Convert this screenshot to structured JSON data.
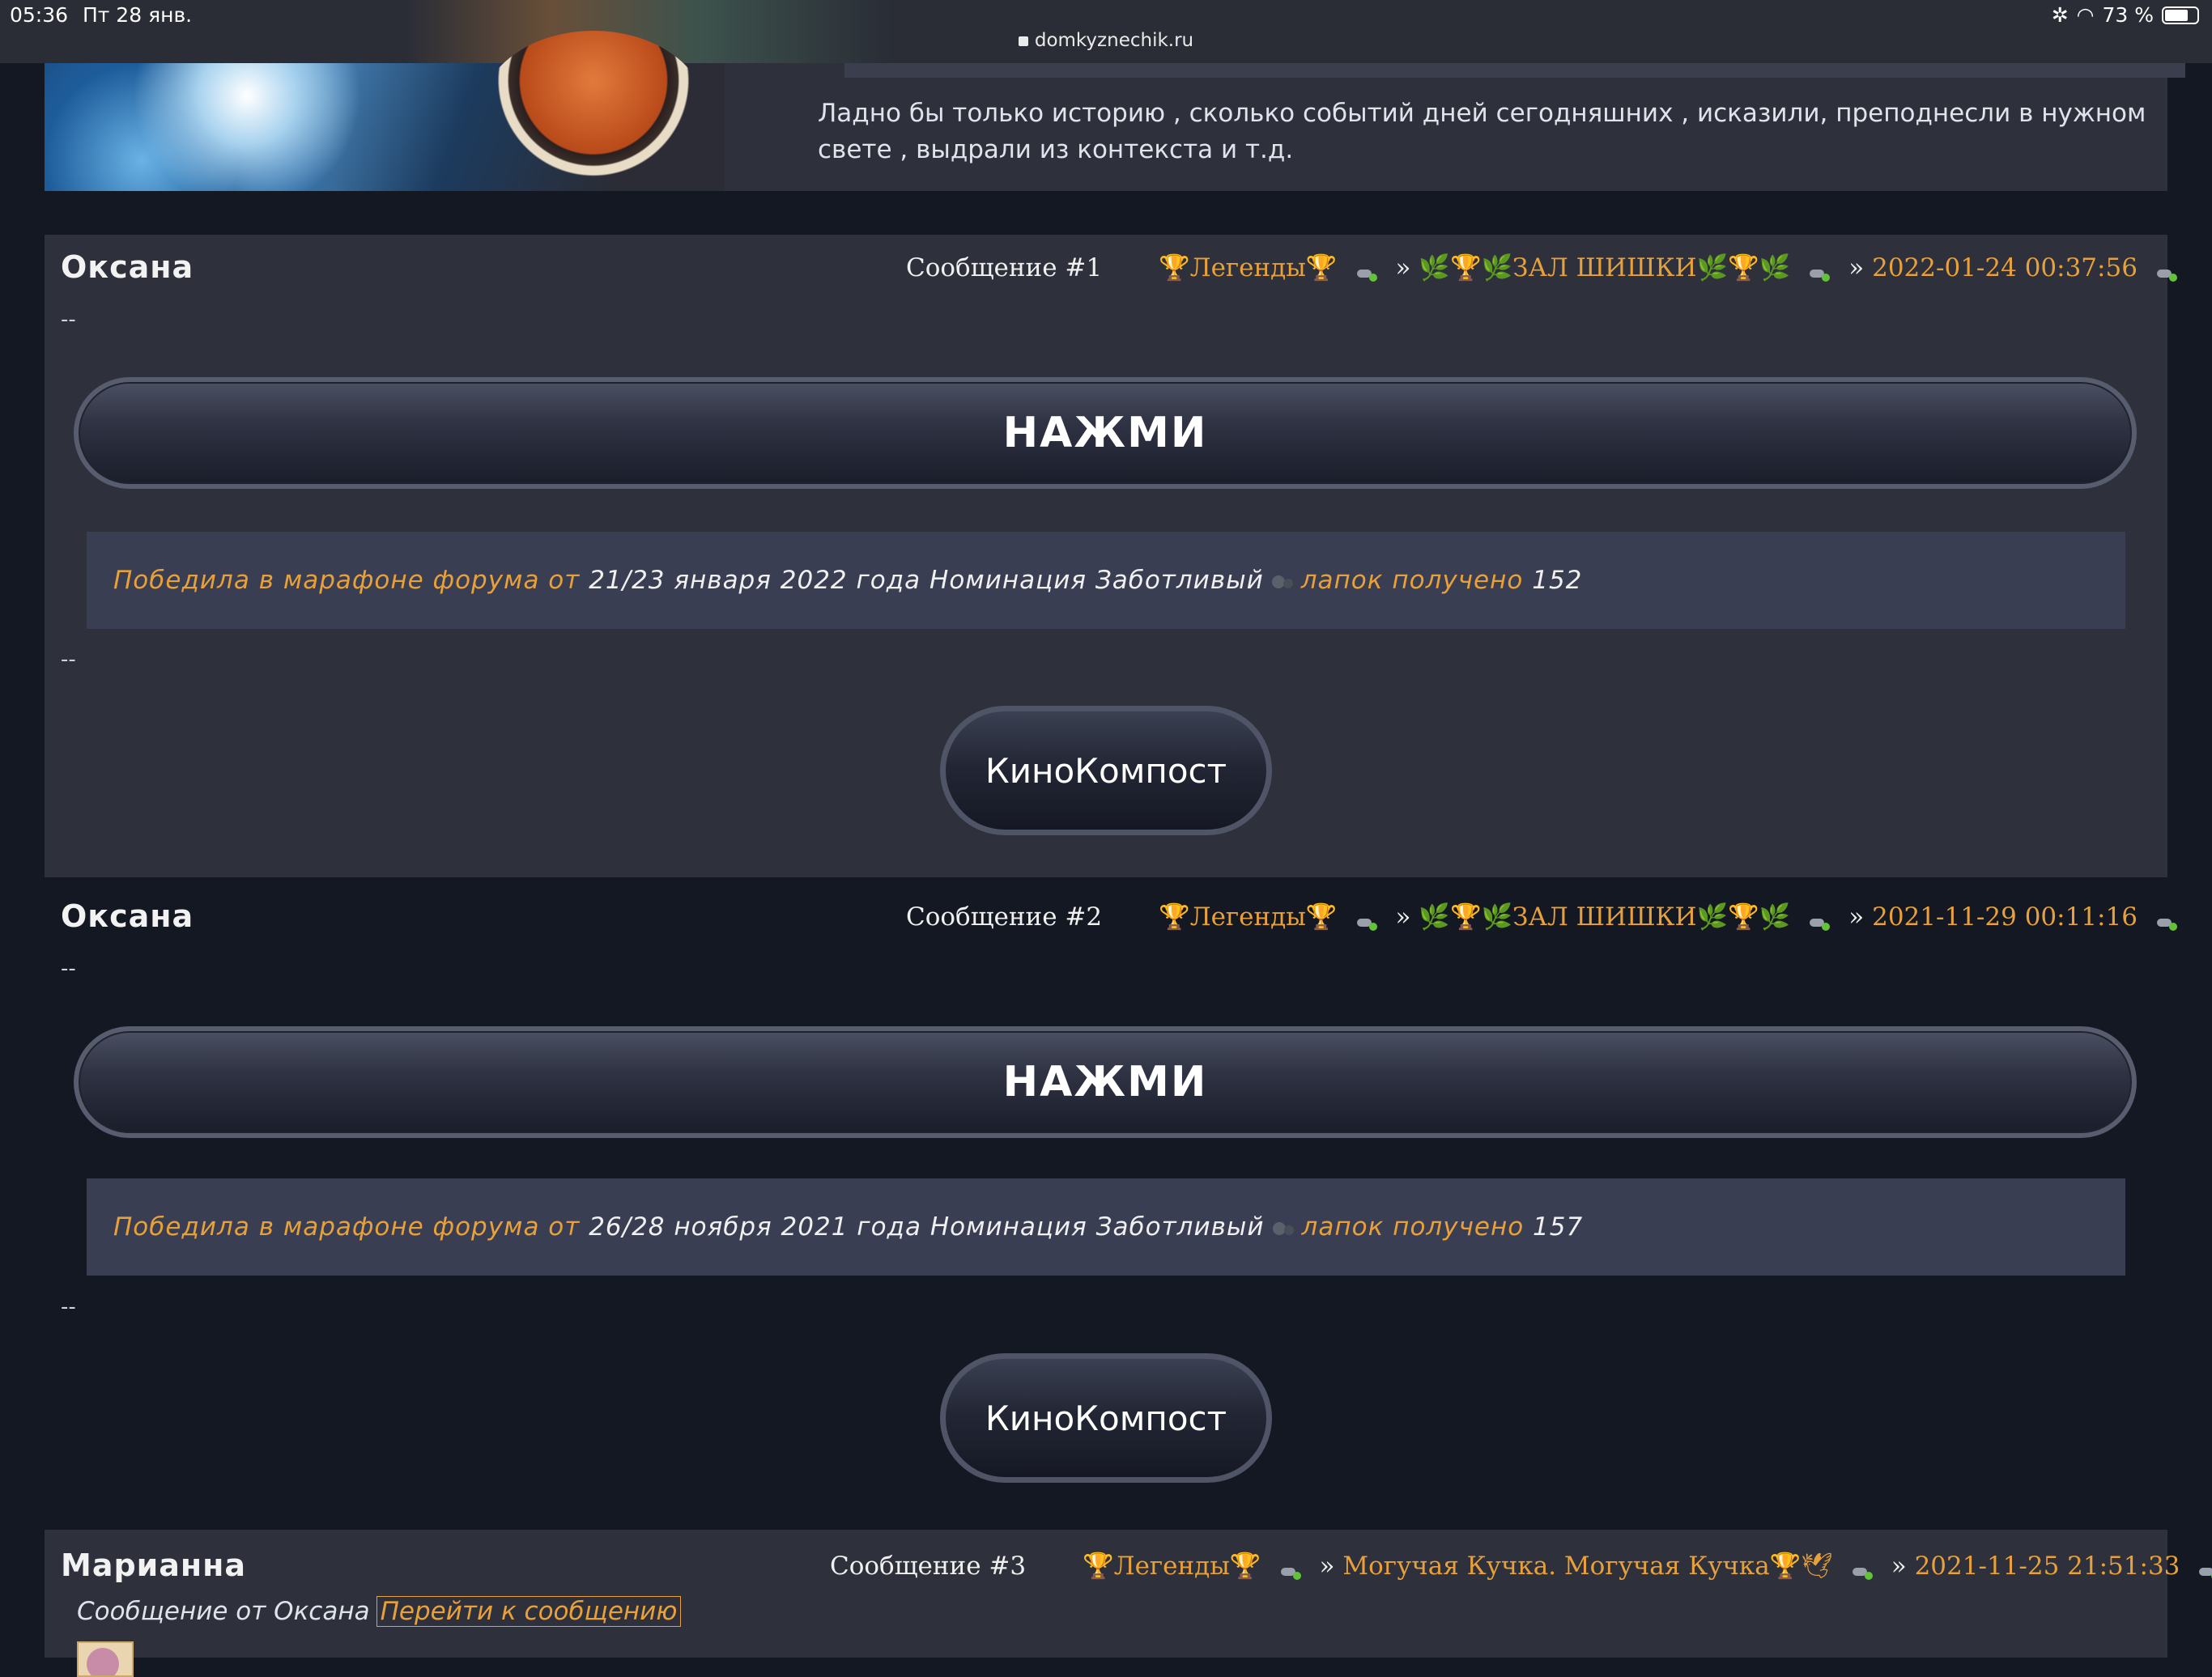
{
  "status_bar": {
    "time": "05:36",
    "date": "Пт 28 янв.",
    "battery": "73 %",
    "battery_level": 0.73,
    "url": "domkyznechik.ru"
  },
  "previous_post": {
    "text": "Ладно бы только историю , сколько событий дней сегодняшних , исказили, преподнесли в нужном свете , выдрали из контекста и т.д."
  },
  "posts": [
    {
      "author": "Оксана",
      "number": "Сообщение #1",
      "category": "🏆Легенды🏆",
      "separator1": "»",
      "topic": "🌿🏆🌿ЗАЛ ШИШКИ🌿🏆🌿",
      "separator2": "»",
      "date": "2022-01-24 00:37:56",
      "dash_top": "--",
      "button_label": "НАЖМИ",
      "award_prefix": "Победила в марафоне форума от",
      "award_dates": "21/23 января 2022 года Номинация Заботливый",
      "award_paws": "лапок получено",
      "award_count": "152",
      "dash_bottom": "--",
      "small_button": "КиноКомпост"
    },
    {
      "author": "Оксана",
      "number": "Сообщение #2",
      "category": "🏆Легенды🏆",
      "separator1": "»",
      "topic": "🌿🏆🌿ЗАЛ ШИШКИ🌿🏆🌿",
      "separator2": "»",
      "date": "2021-11-29 00:11:16",
      "dash_top": "--",
      "button_label": "НАЖМИ",
      "award_prefix": "Победила в марафоне форума от",
      "award_dates": "26/28 ноября 2021 года Номинация Заботливый",
      "award_paws": "лапок получено",
      "award_count": "157",
      "dash_bottom": "--",
      "small_button": "КиноКомпост"
    },
    {
      "author": "Марианна",
      "number": "Сообщение #3",
      "category": "🏆Легенды🏆",
      "separator1": "»",
      "topic": "Могучая Кучка. Могучая Кучка🏆🕊",
      "separator2": "»",
      "date": "2021-11-25 21:51:33",
      "quote_from": "Сообщение от Оксана",
      "goto_link": "Перейти к сообщению"
    }
  ]
}
